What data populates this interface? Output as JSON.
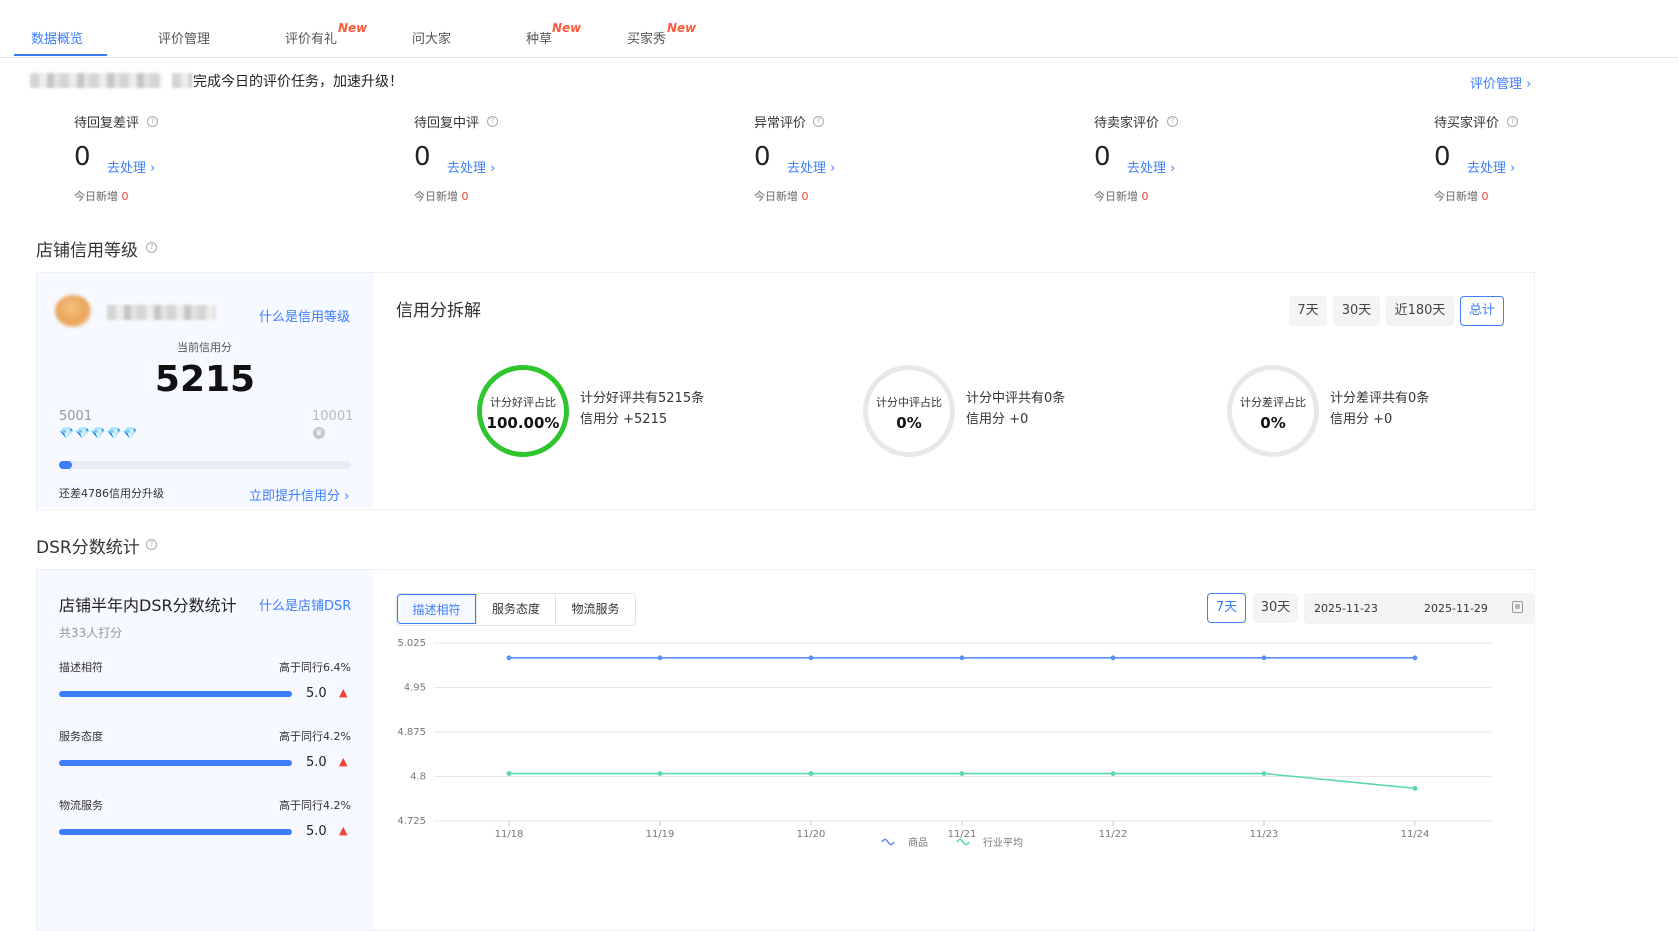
{
  "tabs": [
    {
      "label": "数据概览",
      "active": true,
      "badge": ""
    },
    {
      "label": "评价管理",
      "active": false,
      "badge": ""
    },
    {
      "label": "评价有礼",
      "active": false,
      "badge": "New"
    },
    {
      "label": "问大家",
      "active": false,
      "badge": ""
    },
    {
      "label": "种草",
      "active": false,
      "badge": "New"
    },
    {
      "label": "买家秀",
      "active": false,
      "badge": "New"
    }
  ],
  "banner": {
    "message": "完成今日的评价任务，加速升级！",
    "manage_link": "评价管理 ›"
  },
  "stats": [
    {
      "title": "待回复差评",
      "value": "0",
      "link": "去处理 ›",
      "sub": "今日新增",
      "sub_value": "0"
    },
    {
      "title": "待回复中评",
      "value": "0",
      "link": "去处理 ›",
      "sub": "今日新增",
      "sub_value": "0"
    },
    {
      "title": "异常评价",
      "value": "0",
      "link": "去处理 ›",
      "sub": "今日新增",
      "sub_value": "0"
    },
    {
      "title": "待卖家评价",
      "value": "0",
      "link": "去处理 ›",
      "sub": "今日新增",
      "sub_value": "0"
    },
    {
      "title": "待买家评价",
      "value": "0",
      "link": "去处理 ›",
      "sub": "今日新增",
      "sub_value": "0"
    }
  ],
  "credit": {
    "section_title": "店铺信用等级",
    "what_link": "什么是信用等级",
    "current_label": "当前信用分",
    "score": "5215",
    "min": "5001",
    "max": "10001",
    "progress": 0.043,
    "remain_text": "还差4786信用分升级",
    "boost_link": "立即提升信用分 ›",
    "diamond_count": 5,
    "breakdown_title": "信用分拆解",
    "periods": [
      "7天",
      "30天",
      "近180天",
      "总计"
    ],
    "selected_period": "总计",
    "items": [
      {
        "ring_label": "计分好评占比",
        "ring_value": "100.00%",
        "line1": "计分好评共有5215条",
        "line2": "信用分 +5215",
        "ratio": 1.0,
        "color": "#2ec52e"
      },
      {
        "ring_label": "计分中评占比",
        "ring_value": "0%",
        "line1": "计分中评共有0条",
        "line2": "信用分 +0",
        "ratio": 0,
        "color": "#e8e8e8"
      },
      {
        "ring_label": "计分差评占比",
        "ring_value": "0%",
        "line1": "计分差评共有0条",
        "line2": "信用分 +0",
        "ratio": 0,
        "color": "#e8e8e8"
      }
    ]
  },
  "dsr": {
    "section_title": "DSR分数统计",
    "card_title": "店铺半年内DSR分数统计",
    "what_link": "什么是店铺DSR",
    "count_text": "共33人打分",
    "items": [
      {
        "name": "描述相符",
        "compare": "高于同行6.4%",
        "score": "5.0",
        "fill": 1.0
      },
      {
        "name": "服务态度",
        "compare": "高于同行4.2%",
        "score": "5.0",
        "fill": 1.0
      },
      {
        "name": "物流服务",
        "compare": "高于同行4.2%",
        "score": "5.0",
        "fill": 1.0
      }
    ],
    "metric_tabs": [
      "描述相符",
      "服务态度",
      "物流服务"
    ],
    "selected_metric": "描述相符",
    "periods": [
      "7天",
      "30天"
    ],
    "selected_period": "7天",
    "date_start": "2025-11-23",
    "date_end": "2025-11-29"
  },
  "chart_data": {
    "type": "line",
    "x": [
      "11/18",
      "11/19",
      "11/20",
      "11/21",
      "11/22",
      "11/23",
      "11/24"
    ],
    "ylim": [
      4.725,
      5.025
    ],
    "yticks": [
      "5.025",
      "4.95",
      "4.875",
      "4.8",
      "4.725"
    ],
    "grid": true,
    "legend_position": "bottom-center",
    "series": [
      {
        "name": "商品",
        "color": "#5b8ff9",
        "values": [
          5.0,
          5.0,
          5.0,
          5.0,
          5.0,
          5.0,
          5.0
        ]
      },
      {
        "name": "行业平均",
        "color": "#5ad8a6",
        "values": [
          4.805,
          4.805,
          4.805,
          4.805,
          4.805,
          4.805,
          4.78
        ]
      }
    ]
  }
}
